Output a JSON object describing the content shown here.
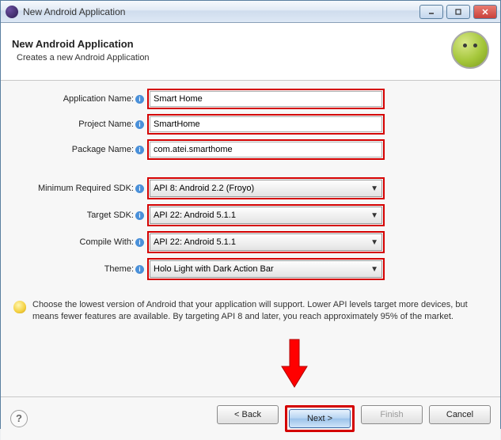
{
  "window": {
    "title": "New Android Application"
  },
  "header": {
    "title": "New Android Application",
    "subtitle": "Creates a new Android Application"
  },
  "form": {
    "app_name": {
      "label": "Application Name:",
      "value": "Smart Home"
    },
    "project_name": {
      "label": "Project Name:",
      "value": "SmartHome"
    },
    "package_name": {
      "label": "Package Name:",
      "value": "com.atei.smarthome"
    },
    "min_sdk": {
      "label": "Minimum Required SDK:",
      "value": "API 8: Android 2.2 (Froyo)"
    },
    "target_sdk": {
      "label": "Target SDK:",
      "value": "API 22: Android 5.1.1"
    },
    "compile_with": {
      "label": "Compile With:",
      "value": "API 22: Android 5.1.1"
    },
    "theme": {
      "label": "Theme:",
      "value": "Holo Light with Dark Action Bar"
    }
  },
  "hint": "Choose the lowest version of Android that your application will support. Lower API levels target more devices, but means fewer features are available. By targeting API 8 and later, you reach approximately 95% of the market.",
  "footer": {
    "back": "< Back",
    "next": "Next >",
    "finish": "Finish",
    "cancel": "Cancel"
  }
}
